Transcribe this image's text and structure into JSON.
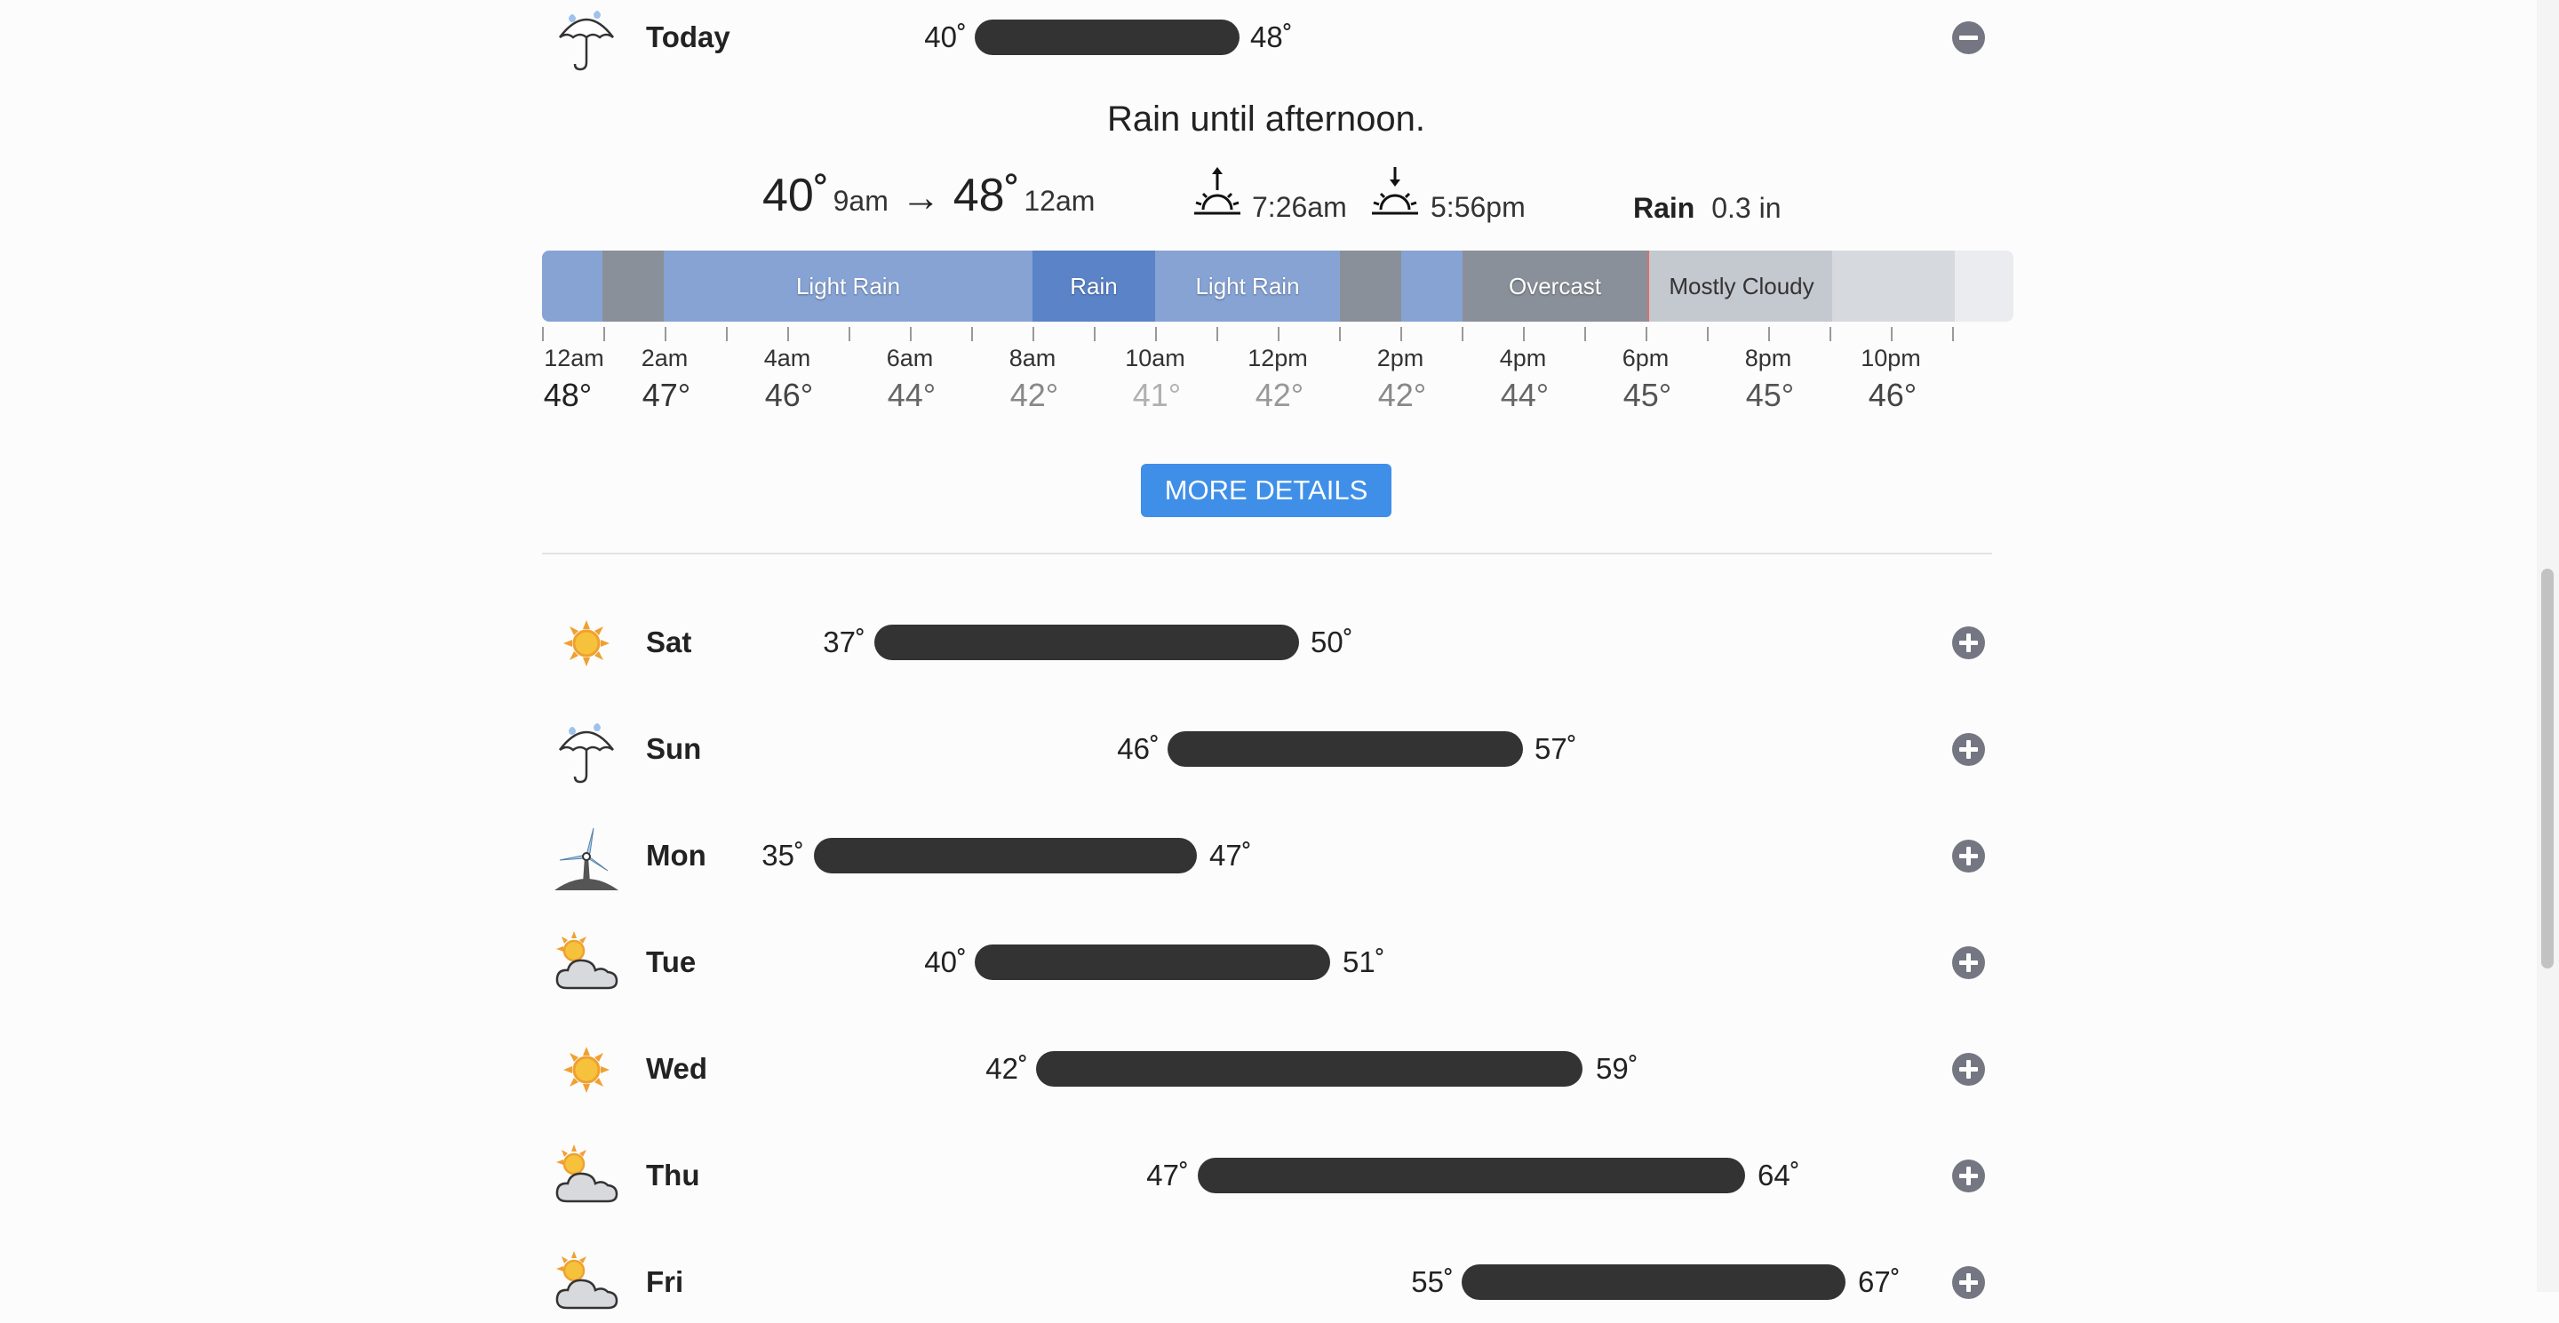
{
  "today": {
    "day": "Today",
    "icon": "umbrella-rain-icon",
    "low": "40˚",
    "high": "48˚",
    "summary": "Rain until afternoon.",
    "low_temp": "40˚",
    "low_time": "9am",
    "arrow": "→",
    "high_temp": "48˚",
    "high_time": "12am",
    "sunrise": "7:26am",
    "sunset": "5:56pm",
    "precip_label": "Rain",
    "precip_value": "0.3 in",
    "segments": [
      {
        "label": "",
        "color": "#86a3d4"
      },
      {
        "label": "",
        "color": "#8a9099"
      },
      {
        "label": "Light Rain",
        "color": "#86a3d4"
      },
      {
        "label": "Rain",
        "color": "#5a83c8"
      },
      {
        "label": "Light Rain",
        "color": "#86a3d4"
      },
      {
        "label": "",
        "color": "#8a9099"
      },
      {
        "label": "",
        "color": "#86a3d4"
      },
      {
        "label": "Overcast",
        "color": "#8a9099"
      },
      {
        "label": "Mostly Cloudy",
        "color": "#c4c8cf"
      },
      {
        "label": "",
        "color": "#d6d9de"
      },
      {
        "label": "",
        "color": "#ebecef"
      }
    ],
    "hours": [
      {
        "time": "12am",
        "temp": "48°",
        "color": "#222"
      },
      {
        "time": "2am",
        "temp": "47°",
        "color": "#333"
      },
      {
        "time": "4am",
        "temp": "46°",
        "color": "#444"
      },
      {
        "time": "6am",
        "temp": "44°",
        "color": "#666"
      },
      {
        "time": "8am",
        "temp": "42°",
        "color": "#888"
      },
      {
        "time": "10am",
        "temp": "41°",
        "color": "#aaa"
      },
      {
        "time": "12pm",
        "temp": "42°",
        "color": "#888"
      },
      {
        "time": "2pm",
        "temp": "42°",
        "color": "#888"
      },
      {
        "time": "4pm",
        "temp": "44°",
        "color": "#666"
      },
      {
        "time": "6pm",
        "temp": "45°",
        "color": "#555"
      },
      {
        "time": "8pm",
        "temp": "45°",
        "color": "#555"
      },
      {
        "time": "10pm",
        "temp": "46°",
        "color": "#444"
      }
    ],
    "more_details": "MORE DETAILS"
  },
  "days": [
    {
      "name": "Sat",
      "icon": "sun-icon",
      "low": "37˚",
      "high": "50˚"
    },
    {
      "name": "Sun",
      "icon": "umbrella-rain-icon",
      "low": "46˚",
      "high": "57˚"
    },
    {
      "name": "Mon",
      "icon": "wind-turbine-icon",
      "low": "35˚",
      "high": "47˚"
    },
    {
      "name": "Tue",
      "icon": "partly-cloudy-icon",
      "low": "40˚",
      "high": "51˚"
    },
    {
      "name": "Wed",
      "icon": "sun-icon",
      "low": "42˚",
      "high": "59˚"
    },
    {
      "name": "Thu",
      "icon": "partly-cloudy-icon",
      "low": "47˚",
      "high": "64˚"
    },
    {
      "name": "Fri",
      "icon": "partly-cloudy-icon",
      "low": "55˚",
      "high": "67˚"
    }
  ]
}
